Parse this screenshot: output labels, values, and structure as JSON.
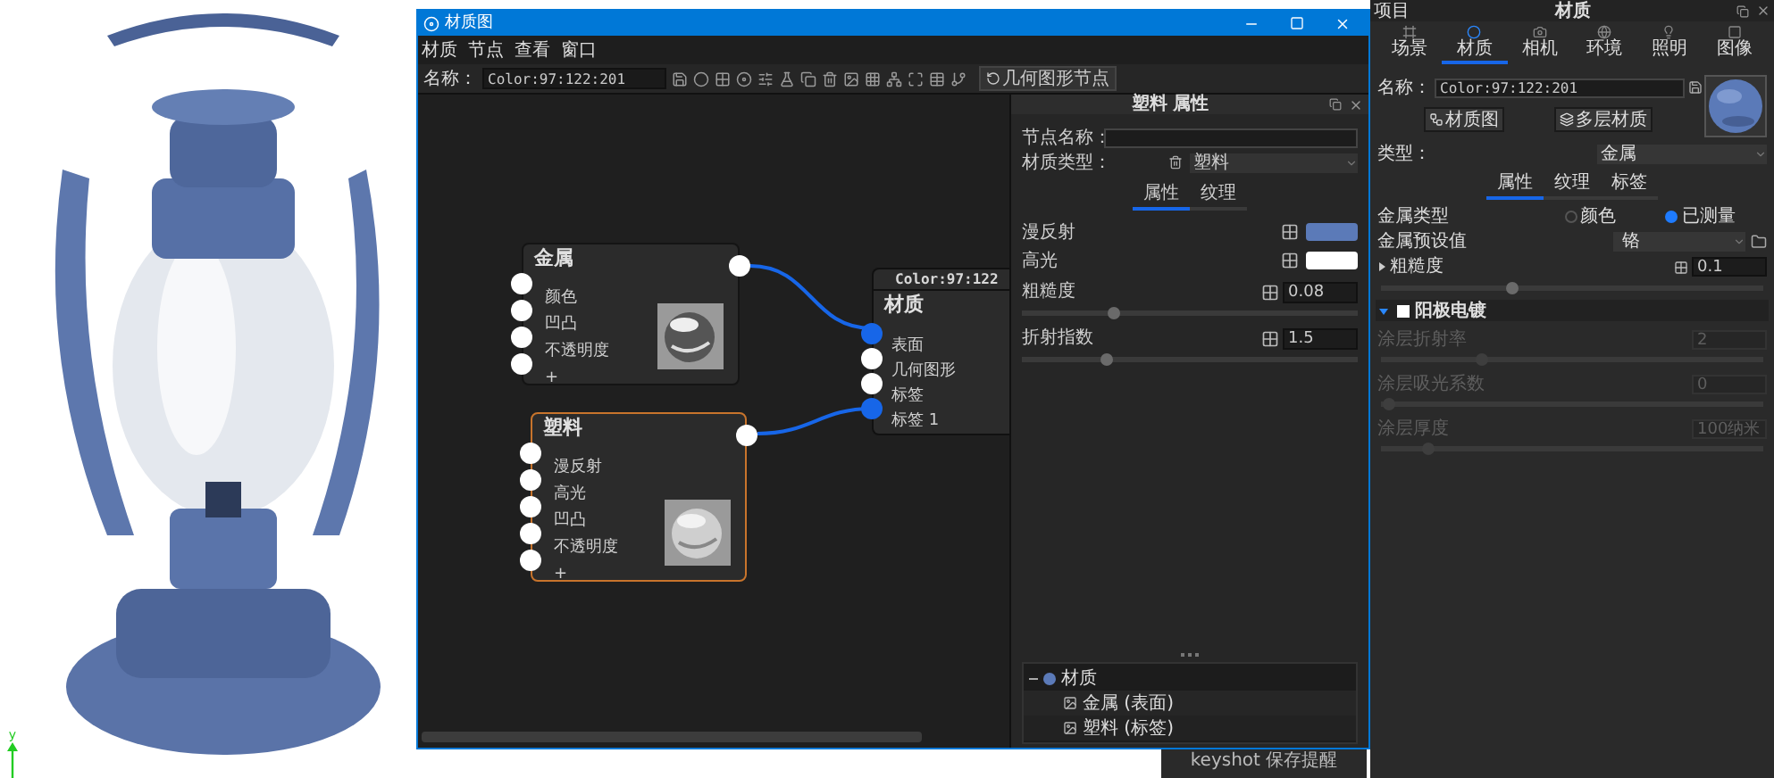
{
  "viewport": {
    "axis_label": "y"
  },
  "graph_window": {
    "title": "材质图",
    "menu": [
      "材质",
      "节点",
      "查看",
      "窗口"
    ],
    "name_label": "名称：",
    "name_value": "Color:97:122:201",
    "geometry_button": "几何图形节点",
    "nodes": [
      {
        "kind": "shader",
        "title": "金属",
        "selected": false,
        "ports": [
          "颜色",
          "凹凸",
          "不透明度",
          "+"
        ]
      },
      {
        "kind": "shader",
        "title": "塑料",
        "selected": true,
        "ports": [
          "漫反射",
          "高光",
          "凹凸",
          "不透明度",
          "+"
        ]
      },
      {
        "kind": "material",
        "header": "Color:97:122",
        "title": "材质",
        "inputs": [
          {
            "label": "表面",
            "connected": true
          },
          {
            "label": "几何图形",
            "connected": false
          },
          {
            "label": "标签",
            "connected": false
          },
          {
            "label": "标签 1",
            "connected": true
          }
        ]
      }
    ],
    "properties": {
      "title": "塑料 属性",
      "node_name_label": "节点名称：",
      "type_label": "材质类型：",
      "type_value": "塑料",
      "tabs": [
        {
          "label": "属性",
          "selected": true
        },
        {
          "label": "纹理",
          "selected": false
        }
      ],
      "rows": [
        {
          "kind": "color",
          "label": "漫反射",
          "color": "#5b7ab8"
        },
        {
          "kind": "color",
          "label": "高光",
          "color": "#ffffff"
        },
        {
          "kind": "slider",
          "label": "粗糙度",
          "value": "0.08",
          "level": 0.27
        },
        {
          "kind": "slider",
          "label": "折射指数",
          "value": "1.5",
          "level": 0.25
        }
      ]
    },
    "tree": {
      "label": "材质",
      "expanded": true,
      "children": [
        {
          "label": "金属 (表面)"
        },
        {
          "label": "塑料 (标签)"
        }
      ]
    }
  },
  "save_dialog": {
    "title": "keyshot 保存提醒"
  },
  "project_panel": {
    "header": "项目",
    "title": "材质",
    "tabs": [
      {
        "label": "场景",
        "selected": false
      },
      {
        "label": "材质",
        "selected": true
      },
      {
        "label": "相机",
        "selected": false
      },
      {
        "label": "环境",
        "selected": false
      },
      {
        "label": "照明",
        "selected": false
      },
      {
        "label": "图像",
        "selected": false
      }
    ],
    "name_label": "名称：",
    "name_value": "Color:97:122:201",
    "buttons": [
      "材质图",
      "多层材质"
    ],
    "type_label": "类型：",
    "type_value": "金属",
    "subtabs": [
      {
        "label": "属性",
        "selected": true
      },
      {
        "label": "纹理",
        "selected": false
      },
      {
        "label": "标签",
        "selected": false
      }
    ],
    "rows": [
      {
        "kind": "radio",
        "label": "金属类型",
        "options": [
          {
            "label": "颜色",
            "selected": false
          },
          {
            "label": "已测量",
            "selected": true
          }
        ]
      },
      {
        "kind": "dropdown",
        "label": "金属预设值",
        "value": "铬"
      },
      {
        "kind": "slider",
        "label": "粗糙度",
        "value": "0.1",
        "level": 0.34,
        "expanded": false
      }
    ],
    "section": {
      "label": "阳极电镀",
      "expanded": true,
      "checked": false,
      "rows": [
        {
          "label": "涂层折射率",
          "value": "2",
          "level": 0.26,
          "disabled": true
        },
        {
          "label": "涂层吸光系数",
          "value": "0",
          "level": 0.02,
          "disabled": true
        },
        {
          "label": "涂层厚度",
          "value": "100纳米",
          "level": 0.12,
          "disabled": true
        }
      ]
    }
  }
}
